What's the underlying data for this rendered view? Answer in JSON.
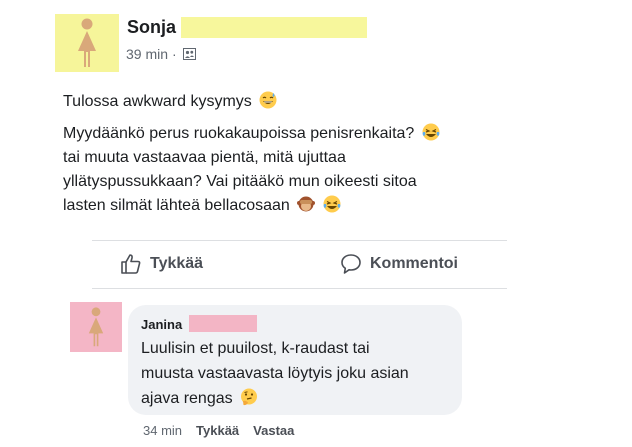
{
  "post": {
    "author": "Sonja",
    "time": "39 min",
    "separator": "·",
    "audience_icon": "friends-icon",
    "text_intro": "Tulossa awkward kysymys",
    "text_lines": [
      "Myydäänkö perus ruokakaupoissa penisrenkaita?",
      "tai muuta vastaavaa pientä, mitä ujuttaa",
      "yllätyspussukkaan? Vai pitääkö mun oikeesti sitoa",
      "lasten silmät lähteä bellacosaan"
    ],
    "emojis": [
      "grinning-sweat-emoji",
      "laughing-tears-emoji",
      "see-no-evil-monkey-emoji",
      "laughing-tears-emoji"
    ]
  },
  "actions": {
    "like_label": "Tykkää",
    "comment_label": "Kommentoi"
  },
  "comment": {
    "author": "Janina",
    "text_lines": [
      "Luulisin et puuilost, k-raudast tai",
      "muusta vastaavasta löytyis joku asian",
      "ajava rengas"
    ],
    "emoji": "thinking-face-emoji",
    "time": "34 min",
    "like_label": "Tykkää",
    "reply_label": "Vastaa"
  },
  "colors": {
    "post_avatar_bg": "#f6f59a",
    "comment_avatar_bg": "#f4b6c6",
    "avatar_figure": "#d9a87a",
    "comment_bubble": "#f0f2f5",
    "text_primary": "#1c1e21",
    "text_secondary": "#606770"
  }
}
